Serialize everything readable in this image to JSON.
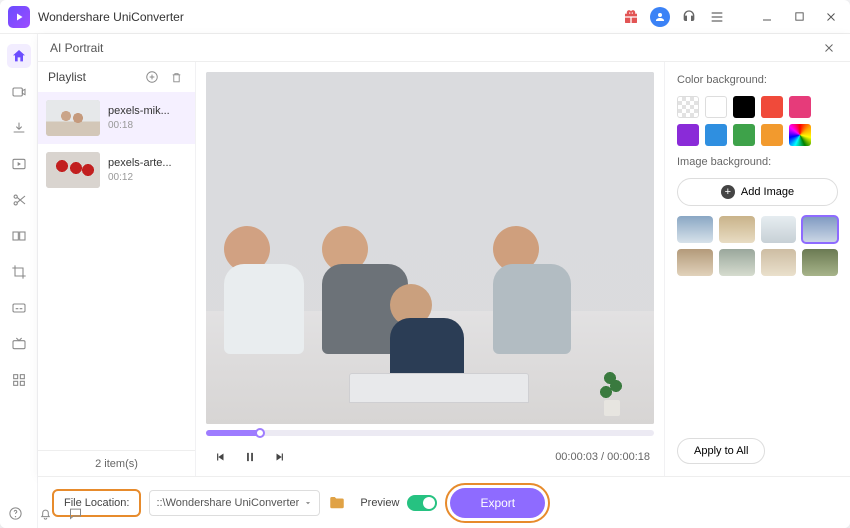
{
  "titlebar": {
    "app_name": "Wondershare UniConverter"
  },
  "modal": {
    "title": "AI Portrait"
  },
  "playlist": {
    "heading": "Playlist",
    "items": [
      {
        "name": "pexels-mik...",
        "duration": "00:18"
      },
      {
        "name": "pexels-arte...",
        "duration": "00:12"
      }
    ],
    "count_text": "2 item(s)"
  },
  "transport": {
    "time_elapsed": "00:00:03",
    "time_total": "00:00:18",
    "time_combined": "00:00:03 / 00:00:18"
  },
  "tools": {
    "color_bg_label": "Color background:",
    "colors_row1": [
      "transparent",
      "#ffffff",
      "#000000",
      "#f04a3a",
      "#e63b7a",
      "#8a2bd8"
    ],
    "colors_row2": [
      "#2f8fe0",
      "#3ea24a",
      "#f29a2e",
      "rainbow"
    ],
    "image_bg_label": "Image background:",
    "add_image_label": "Add Image",
    "bg_thumbs": [
      "linear-gradient(#8aa7c4,#d7e2ea)",
      "linear-gradient(#c9b38a,#e8dcc3)",
      "linear-gradient(#e6edf1,#c7d0d6)",
      "linear-gradient(#7e99c1,#cdd8e6)",
      "linear-gradient(#b39a7a,#e1d2bb)",
      "linear-gradient(#9aa79c,#d6dccf)",
      "linear-gradient(#cdbda3,#eae0cc)",
      "linear-gradient(#6b7a53,#a7b48a)"
    ],
    "selected_thumb_index": 3,
    "apply_all_label": "Apply to All"
  },
  "bottom": {
    "file_location_label": "File Location:",
    "file_path_text": "::\\Wondershare UniConverter",
    "preview_label": "Preview",
    "export_label": "Export",
    "open_label": "Open"
  },
  "icons": {
    "gift": "gift-icon",
    "avatar": "avatar-icon",
    "headset": "headset-icon",
    "menu": "menu-icon",
    "minimize": "minimize-icon",
    "maximize": "maximize-icon",
    "close": "close-icon"
  }
}
